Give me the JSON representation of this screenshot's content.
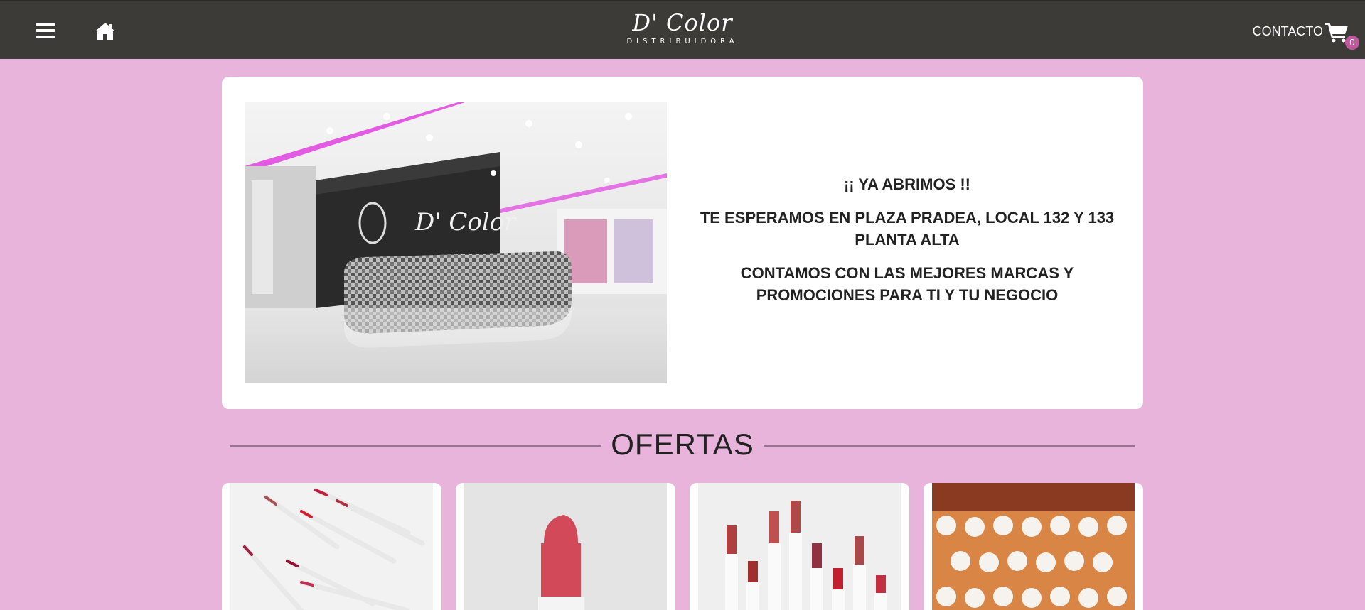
{
  "header": {
    "brand_script": "D' Color",
    "brand_sub": "DISTRIBUIDORA",
    "contact_label": "CONTACTO",
    "cart_count": "0",
    "menu_icon": "hamburger-icon",
    "home_icon": "home-icon",
    "cart_icon": "cart-icon",
    "bar_color": "#3d3b38",
    "badge_color": "#c0589e"
  },
  "hero": {
    "image_alt": "D' Color store interior",
    "headline": "¡¡ YA ABRIMOS !!",
    "location": "TE ESPERAMOS EN PLAZA PRADEA, LOCAL 132 Y 133 PLANTA ALTA",
    "tagline": "CONTAMOS CON LAS MEJORES MARCAS Y PROMOCIONES PARA TI Y TU NEGOCIO"
  },
  "offers": {
    "title": "OFERTAS",
    "products": [
      {
        "alt": "lip liners"
      },
      {
        "alt": "lipstick"
      },
      {
        "alt": "lipsticks"
      },
      {
        "alt": "foundation bottles"
      }
    ]
  },
  "colors": {
    "page_bg": "#e8b4dc",
    "accent_line": "#9b7392",
    "neon": "#e040e0"
  }
}
